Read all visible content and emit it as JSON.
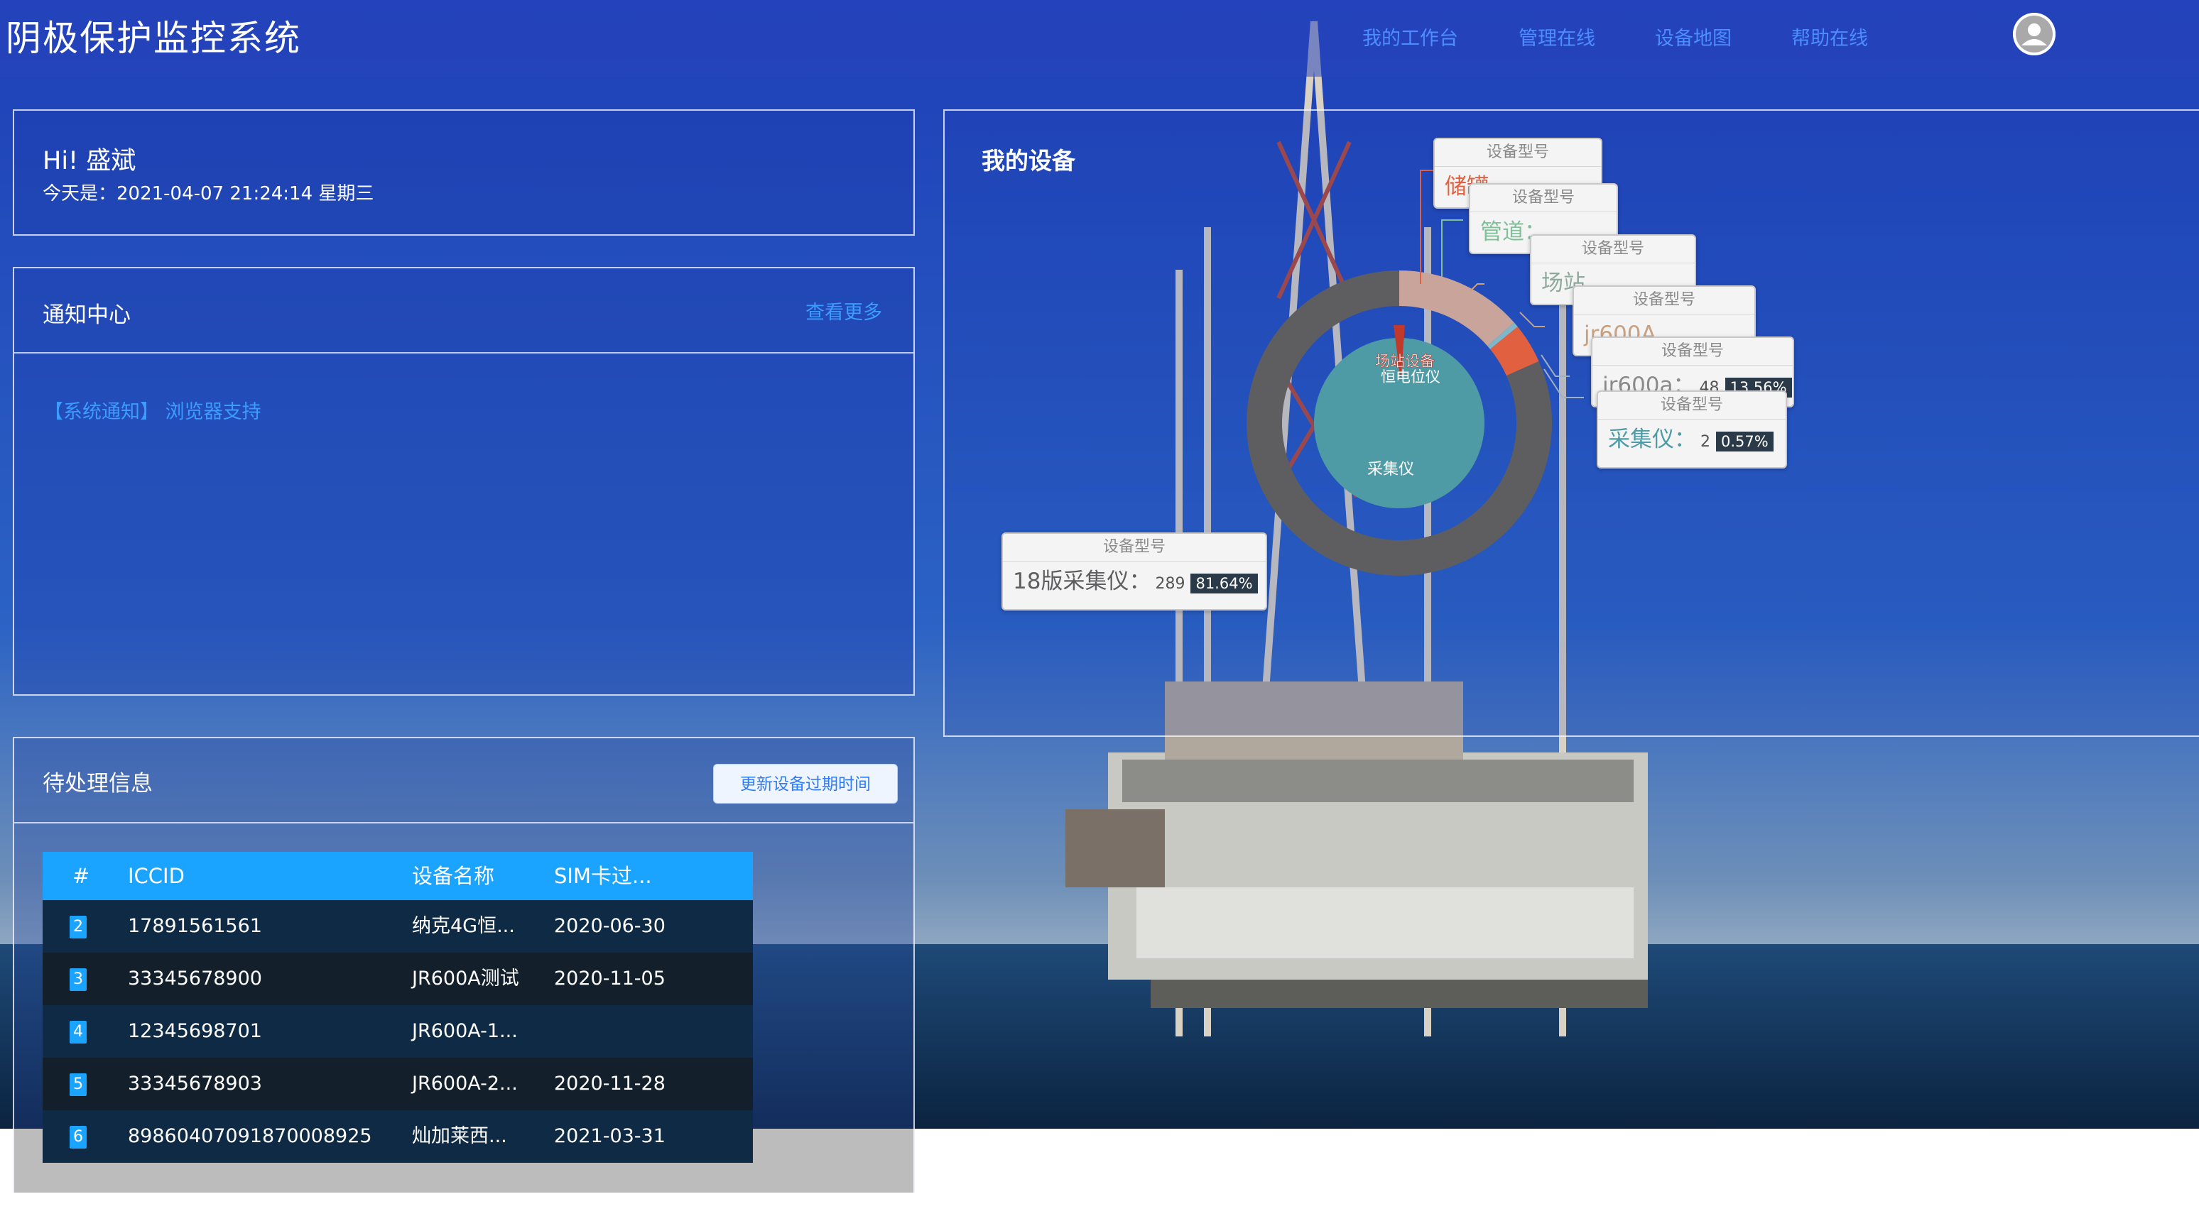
{
  "header": {
    "title": "阴极保护监控系统",
    "nav": [
      "我的工作台",
      "管理在线",
      "设备地图",
      "帮助在线"
    ]
  },
  "greeting": {
    "name": "Hi! 盛斌",
    "date": "今天是：2021-04-07 21:24:14 星期三"
  },
  "notice": {
    "title": "通知中心",
    "more": "查看更多",
    "items": [
      "【系统通知】 浏览器支持"
    ]
  },
  "pending": {
    "title": "待处理信息",
    "update_button": "更新设备过期时间",
    "columns": [
      "#",
      "ICCID",
      "设备名称",
      "SIM卡过..."
    ],
    "rows": [
      {
        "idx": "2",
        "iccid": "17891561561",
        "name": "纳克4G恒...",
        "sim": "2020-06-30"
      },
      {
        "idx": "3",
        "iccid": "33345678900",
        "name": "JR600A测试",
        "sim": "2020-11-05"
      },
      {
        "idx": "4",
        "iccid": "12345698701",
        "name": "JR600A-1...",
        "sim": ""
      },
      {
        "idx": "5",
        "iccid": "33345678903",
        "name": "JR600A-2...",
        "sim": "2020-11-28"
      },
      {
        "idx": "6",
        "iccid": "89860407091870008925",
        "name": "灿加莱西...",
        "sim": "2021-03-31"
      }
    ]
  },
  "devices": {
    "title": "我的设备",
    "tooltip_header": "设备型号",
    "tooltips": [
      {
        "name": "18版采集仪：",
        "count": "289",
        "pct": "81.64%"
      },
      {
        "name": "采集仪：",
        "count": "2",
        "pct": "0.57%"
      },
      {
        "name": "jr600a：",
        "count": "48",
        "pct": "13.56%"
      },
      {
        "name": "jr600A",
        "count": "",
        "pct": ""
      },
      {
        "name": "场站",
        "count": "",
        "pct": ""
      },
      {
        "name": "管道：",
        "count": "",
        "pct": ""
      },
      {
        "name": "储罐",
        "count": "",
        "pct": ""
      }
    ],
    "labels": {
      "inner_top_1": "场站设备",
      "inner_top_2": "恒电位仪",
      "inner_bottom": "采集仪"
    },
    "colors": {
      "main": "#5e5e60",
      "inner": "#4e9ba6",
      "accent": "#c0392b"
    }
  },
  "chart_data": {
    "type": "pie",
    "title": "我的设备",
    "series_name": "设备型号",
    "slices": [
      {
        "label": "18版采集仪",
        "value": 289,
        "percent": 81.64
      },
      {
        "label": "jr600a",
        "value": 48,
        "percent": 13.56
      },
      {
        "label": "采集仪",
        "value": 2,
        "percent": 0.57
      }
    ]
  }
}
